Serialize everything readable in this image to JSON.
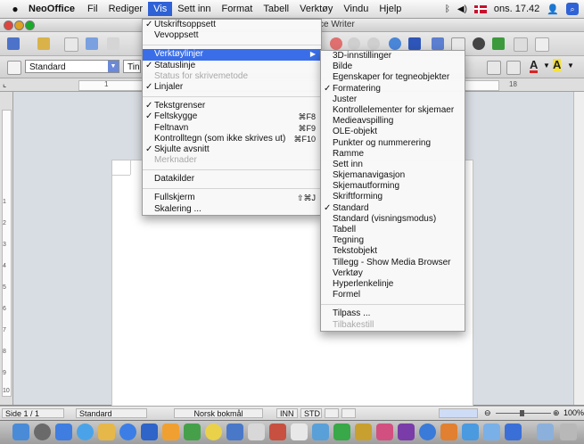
{
  "menubar": {
    "app_name": "NeoOffice",
    "items": [
      "Fil",
      "Rediger",
      "Vis",
      "Sett inn",
      "Format",
      "Tabell",
      "Verktøy",
      "Vindu",
      "Hjelp"
    ],
    "active_item": "Vis",
    "clock": "ons. 17.42"
  },
  "window": {
    "title_fragment": "ce Writer"
  },
  "toolbar2": {
    "style_value": "Standard",
    "font_value_fragment": "Tin"
  },
  "ruler_v_marks": [
    "1",
    "2",
    "3",
    "4",
    "5",
    "6",
    "7",
    "8",
    "9",
    "10"
  ],
  "ruler_h_marks": [
    "1",
    "18"
  ],
  "vis_menu": {
    "items": [
      {
        "label": "Utskriftsoppsett",
        "checked": true
      },
      {
        "label": "Vevoppsett"
      },
      {
        "sep": true
      },
      {
        "label": "Verktøylinjer",
        "submenu": true,
        "highlighted": true
      },
      {
        "label": "Statuslinje",
        "checked": true
      },
      {
        "label": "Status for skrivemetode",
        "disabled": true
      },
      {
        "label": "Linjaler",
        "checked": true
      },
      {
        "sep": true
      },
      {
        "label": "Tekstgrenser",
        "checked": true
      },
      {
        "label": "Feltskygge",
        "checked": true,
        "shortcut": "⌘F8"
      },
      {
        "label": "Feltnavn",
        "shortcut": "⌘F9"
      },
      {
        "label": "Kontrolltegn (som ikke skrives ut)",
        "shortcut": "⌘F10"
      },
      {
        "label": "Skjulte avsnitt",
        "checked": true
      },
      {
        "label": "Merknader",
        "disabled": true
      },
      {
        "sep": true
      },
      {
        "label": "Datakilder"
      },
      {
        "sep": true
      },
      {
        "label": "Fullskjerm",
        "shortcut": "⇧⌘J"
      },
      {
        "label": "Skalering ..."
      }
    ]
  },
  "toolbars_submenu": {
    "items": [
      {
        "label": "3D-innstillinger"
      },
      {
        "label": "Bilde"
      },
      {
        "label": "Egenskaper for tegneobjekter"
      },
      {
        "label": "Formatering",
        "checked": true
      },
      {
        "label": "Juster"
      },
      {
        "label": "Kontrollelementer for skjemaer"
      },
      {
        "label": "Medieavspilling"
      },
      {
        "label": "OLE-objekt"
      },
      {
        "label": "Punkter og nummerering"
      },
      {
        "label": "Ramme"
      },
      {
        "label": "Sett inn"
      },
      {
        "label": "Skjemanavigasjon"
      },
      {
        "label": "Skjemautforming"
      },
      {
        "label": "Skriftforming"
      },
      {
        "label": "Standard",
        "checked": true
      },
      {
        "label": "Standard (visningsmodus)"
      },
      {
        "label": "Tabell"
      },
      {
        "label": "Tegning"
      },
      {
        "label": "Tekstobjekt"
      },
      {
        "label": "Tillegg - Show Media Browser"
      },
      {
        "label": "Verktøy"
      },
      {
        "label": "Hyperlenkelinje"
      },
      {
        "label": "Formel"
      },
      {
        "sep": true
      },
      {
        "label": "Tilpass ..."
      },
      {
        "label": "Tilbakestill",
        "disabled": true
      }
    ]
  },
  "statusbar": {
    "page": "Side 1 / 1",
    "style": "Standard",
    "language": "Norsk bokmål",
    "insert_mode": "INN",
    "selection_mode": "STD",
    "zoom": "100%"
  },
  "colors": {
    "menu_highlight": "#3a6ee8",
    "menubar_active": "#2f62d6"
  }
}
